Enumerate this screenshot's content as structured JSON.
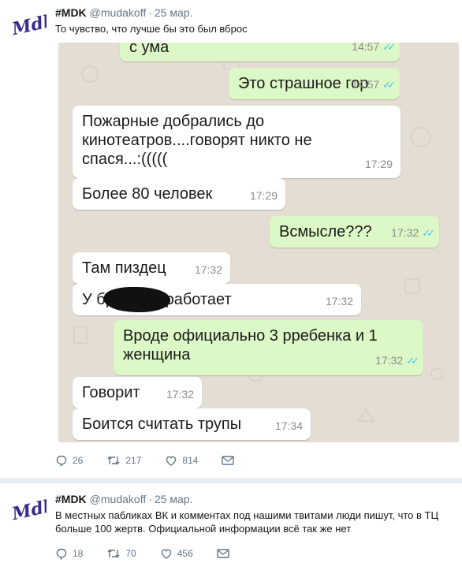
{
  "tweets": [
    {
      "author": "#MDK",
      "handle": "@mudakoff",
      "separator": "·",
      "date": "25 мар.",
      "text": "То чувство, что лучше бы это был вброс",
      "avatar_text": "Mdk",
      "chat": {
        "messages": [
          {
            "dir": "out",
            "text": "с ума",
            "time": "14:57",
            "ticks": "✓✓"
          },
          {
            "dir": "out",
            "text": "Это страшное гор",
            "time": "14:57",
            "ticks": "✓✓"
          },
          {
            "dir": "in",
            "text": "Пожарные добрались до\nкинотеатров....говорят никто не\nспася...:(((((",
            "time": "17:29"
          },
          {
            "dir": "in",
            "text": "Более 80 человек",
            "time": "17:29"
          },
          {
            "dir": "out",
            "text": "Всмысле???",
            "time": "17:32",
            "ticks": "✓✓"
          },
          {
            "dir": "in",
            "text": "Там пиздец",
            "time": "17:32"
          },
          {
            "dir": "in",
            "text": "У        брат там работает",
            "time": "17:32"
          },
          {
            "dir": "out",
            "text": "Вроде официально 3 рребенка и 1\nженщина",
            "time": "17:32",
            "ticks": "✓✓"
          },
          {
            "dir": "in",
            "text": "Говорит",
            "time": "17:32"
          },
          {
            "dir": "in",
            "text": "Боится считать трупы",
            "time": "17:34"
          }
        ]
      },
      "actions": {
        "replies": "26",
        "retweets": "217",
        "likes": "814"
      }
    },
    {
      "author": "#MDK",
      "handle": "@mudakoff",
      "separator": "·",
      "date": "25 мар.",
      "text": "В местных пабликах ВК и комментах под нашими твитами люди пишут, что в ТЦ больше 100 жертв. Официальной информации всё так же нет",
      "avatar_text": "Mdk",
      "actions": {
        "replies": "18",
        "retweets": "70",
        "likes": "456"
      }
    }
  ],
  "colors": {
    "accent": "#1da1f2",
    "avatar_logo": "#3b2a8c",
    "chat_bg": "#e4ddd4",
    "bubble_out": "#dcf8c6",
    "bubble_in": "#ffffff",
    "read_ticks": "#4fc3f7"
  },
  "icons": [
    "reply-icon",
    "retweet-icon",
    "like-icon",
    "direct-message-icon",
    "read-receipt-icon"
  ]
}
